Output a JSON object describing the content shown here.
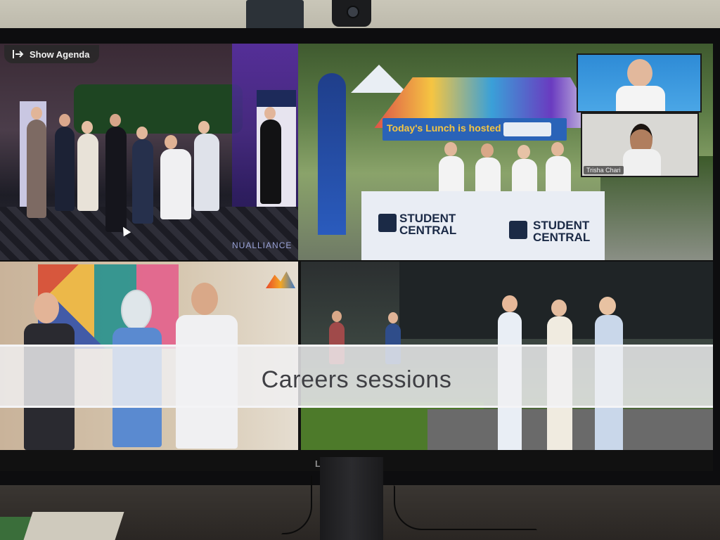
{
  "meeting": {
    "show_agenda_label": "Show Agenda",
    "caption": "Careers sessions",
    "participants": [
      {
        "name": ""
      },
      {
        "name": "Trisha Chari"
      }
    ]
  },
  "slide": {
    "event_banner_text": "Today's Lunch is hosted by",
    "stall_brand": "STUDENT CENTRAL",
    "gala_banner": "NUALLIANCE"
  },
  "device": {
    "monitor_brand": "LG"
  },
  "colors": {
    "caption_bg": "#f0f0f3",
    "caption_text": "#3f3f44",
    "stall_navy": "#1b2a46",
    "tent_sign_blue": "#2a63b8"
  }
}
